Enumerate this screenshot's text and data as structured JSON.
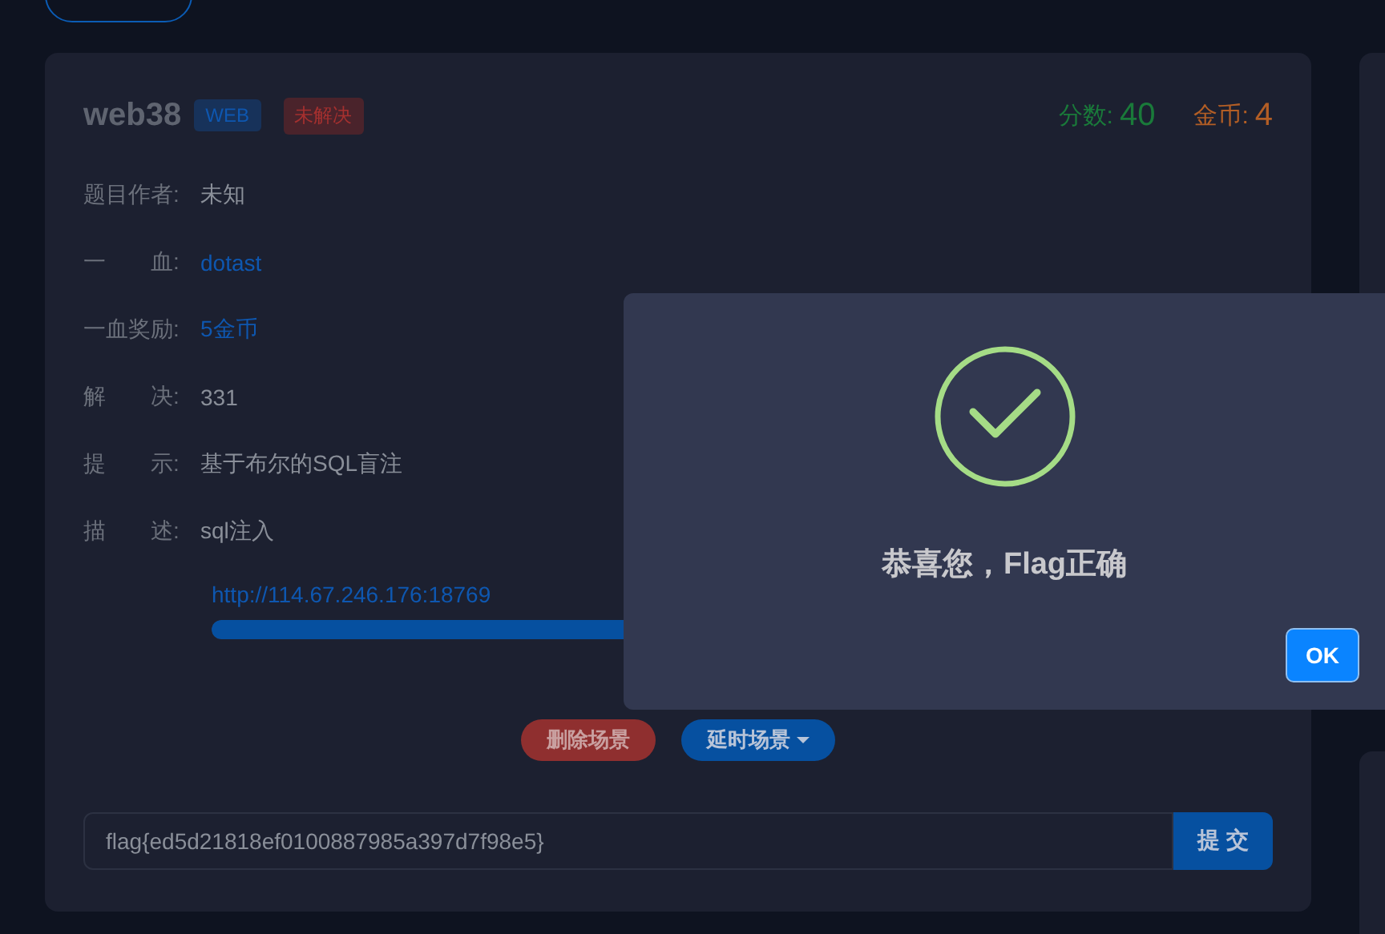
{
  "challenge": {
    "name": "web38",
    "category_tag": "WEB",
    "status_tag": "未解决",
    "solved": false,
    "score_label": "分数:",
    "score": "40",
    "coins_label": "金币:",
    "coins": "4",
    "fields": [
      {
        "label": "题目作者:",
        "value": "未知",
        "kind": "plain"
      },
      {
        "label": "一　　血:",
        "value": "dotast",
        "kind": "link"
      },
      {
        "label": "一血奖励:",
        "value": "5金币",
        "kind": "link"
      },
      {
        "label": "解　　决:",
        "value": "331",
        "kind": "plain"
      },
      {
        "label": "提　　示:",
        "value": "基于布尔的SQL盲注",
        "kind": "plain"
      },
      {
        "label": "描　　述:",
        "value": "sql注入",
        "kind": "plain"
      }
    ],
    "scene_url": "http://114.67.246.176:18769",
    "scene_time": {
      "level": 1
    },
    "buttons": [
      {
        "label": "删除场景",
        "kind": "danger",
        "dropdown": false
      },
      {
        "label": "延时场景",
        "kind": "primary",
        "dropdown": true
      }
    ],
    "flag_input": {
      "value": "flag{ed5d21818ef0100887985a397d7f98e5}"
    },
    "submit": "提 交"
  },
  "dialog": {
    "message": "恭喜您，Flag正确",
    "ok": "OK"
  }
}
